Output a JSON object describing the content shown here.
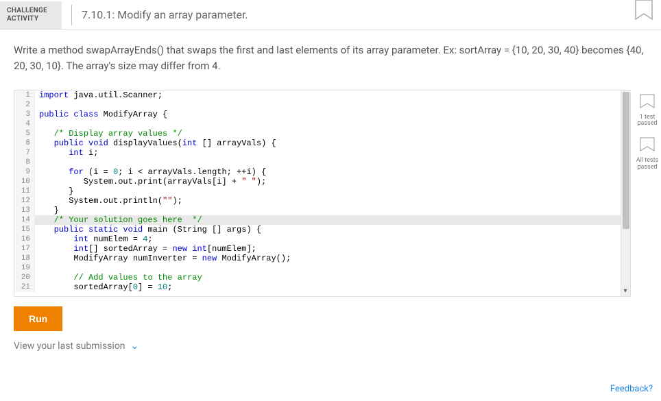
{
  "header": {
    "activity_line1": "CHALLENGE",
    "activity_line2": "ACTIVITY",
    "title": "7.10.1: Modify an array parameter."
  },
  "description": "Write a method swapArrayEnds() that swaps the first and last elements of its array parameter. Ex: sortArray = {10, 20, 30, 40} becomes {40, 20, 30, 10}. The array's size may differ from 4.",
  "code": {
    "highlighted_line": 14,
    "lines": [
      {
        "n": 1,
        "tokens": [
          {
            "t": "import ",
            "c": "kw"
          },
          {
            "t": "java.util.Scanner;",
            "c": "id"
          }
        ]
      },
      {
        "n": 2,
        "tokens": []
      },
      {
        "n": 3,
        "tokens": [
          {
            "t": "public class ",
            "c": "kw"
          },
          {
            "t": "ModifyArray {",
            "c": "id"
          }
        ]
      },
      {
        "n": 4,
        "tokens": []
      },
      {
        "n": 5,
        "tokens": [
          {
            "t": "   ",
            "c": "id"
          },
          {
            "t": "/* Display array values */",
            "c": "cm"
          }
        ]
      },
      {
        "n": 6,
        "tokens": [
          {
            "t": "   ",
            "c": "id"
          },
          {
            "t": "public void ",
            "c": "kw"
          },
          {
            "t": "displayValues(",
            "c": "id"
          },
          {
            "t": "int",
            "c": "kw"
          },
          {
            "t": " [] arrayVals) {",
            "c": "id"
          }
        ]
      },
      {
        "n": 7,
        "tokens": [
          {
            "t": "      ",
            "c": "id"
          },
          {
            "t": "int",
            "c": "kw"
          },
          {
            "t": " i;",
            "c": "id"
          }
        ]
      },
      {
        "n": 8,
        "tokens": []
      },
      {
        "n": 9,
        "tokens": [
          {
            "t": "      ",
            "c": "id"
          },
          {
            "t": "for",
            "c": "kw"
          },
          {
            "t": " (i = ",
            "c": "id"
          },
          {
            "t": "0",
            "c": "num"
          },
          {
            "t": "; i < arrayVals.length; ++i) {",
            "c": "id"
          }
        ]
      },
      {
        "n": 10,
        "tokens": [
          {
            "t": "         System.out.print(arrayVals[i] + ",
            "c": "id"
          },
          {
            "t": "\" \"",
            "c": "str"
          },
          {
            "t": ");",
            "c": "id"
          }
        ]
      },
      {
        "n": 11,
        "tokens": [
          {
            "t": "      }",
            "c": "id"
          }
        ]
      },
      {
        "n": 12,
        "tokens": [
          {
            "t": "      System.out.println(",
            "c": "id"
          },
          {
            "t": "\"\"",
            "c": "str"
          },
          {
            "t": ");",
            "c": "id"
          }
        ]
      },
      {
        "n": 13,
        "tokens": [
          {
            "t": "   }",
            "c": "id"
          }
        ]
      },
      {
        "n": 14,
        "tokens": [
          {
            "t": "   ",
            "c": "id"
          },
          {
            "t": "/* Your solution goes here  */",
            "c": "cm"
          }
        ]
      },
      {
        "n": 15,
        "tokens": [
          {
            "t": "   ",
            "c": "id"
          },
          {
            "t": "public static void ",
            "c": "kw"
          },
          {
            "t": "main (String [] args) {",
            "c": "id"
          }
        ]
      },
      {
        "n": 16,
        "tokens": [
          {
            "t": "       ",
            "c": "id"
          },
          {
            "t": "int",
            "c": "kw"
          },
          {
            "t": " numElem = ",
            "c": "id"
          },
          {
            "t": "4",
            "c": "num"
          },
          {
            "t": ";",
            "c": "id"
          }
        ]
      },
      {
        "n": 17,
        "tokens": [
          {
            "t": "       ",
            "c": "id"
          },
          {
            "t": "int",
            "c": "kw"
          },
          {
            "t": "[] sortedArray = ",
            "c": "id"
          },
          {
            "t": "new int",
            "c": "kw"
          },
          {
            "t": "[numElem];",
            "c": "id"
          }
        ]
      },
      {
        "n": 18,
        "tokens": [
          {
            "t": "       ModifyArray numInverter = ",
            "c": "id"
          },
          {
            "t": "new",
            "c": "kw"
          },
          {
            "t": " ModifyArray();",
            "c": "id"
          }
        ]
      },
      {
        "n": 19,
        "tokens": []
      },
      {
        "n": 20,
        "tokens": [
          {
            "t": "       ",
            "c": "id"
          },
          {
            "t": "// Add values to the array",
            "c": "cm"
          }
        ]
      },
      {
        "n": 21,
        "tokens": [
          {
            "t": "       sortedArray[",
            "c": "id"
          },
          {
            "t": "0",
            "c": "num"
          },
          {
            "t": "] = ",
            "c": "id"
          },
          {
            "t": "10",
            "c": "num"
          },
          {
            "t": ";",
            "c": "id"
          }
        ]
      }
    ]
  },
  "badges": {
    "one_test": "1 test\npassed",
    "all_tests": "All tests\npassed"
  },
  "actions": {
    "run": "Run",
    "last_submission": "View your last submission"
  },
  "feedback_link": "Feedback?"
}
